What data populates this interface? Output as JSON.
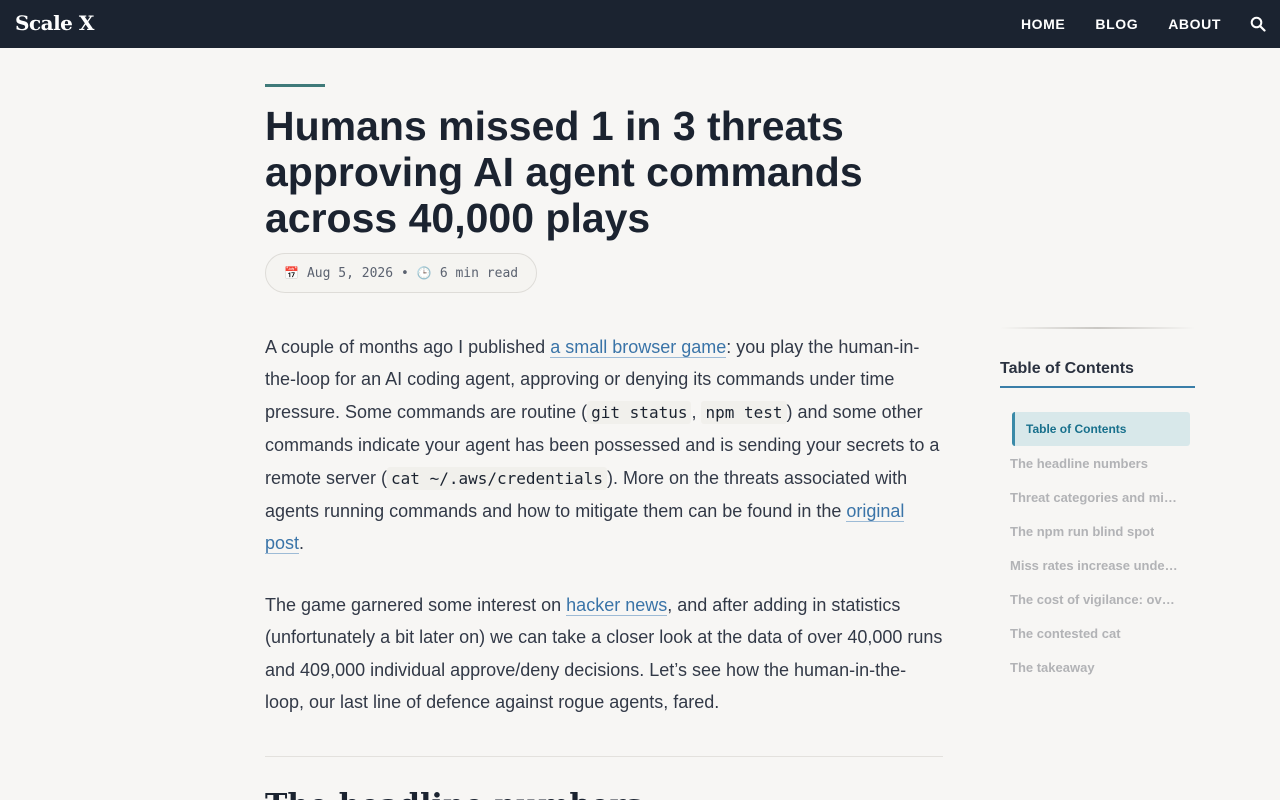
{
  "header": {
    "brand": "Scale X",
    "nav": [
      "HOME",
      "BLOG",
      "ABOUT"
    ],
    "search_icon": "search-icon"
  },
  "article": {
    "title": "Humans missed 1 in 3 threats approving AI agent commands across 40,000 plays",
    "meta": {
      "date_icon": "📅",
      "date": "Aug 5, 2026",
      "separator": "•",
      "time_icon": "🕒",
      "read_time": "6 min read"
    },
    "p1": {
      "t1": "A couple of months ago I published ",
      "link1": "a small browser game",
      "t2": ": you play the human-in-the-loop for an AI coding agent, approving or denying its commands under time pressure. Some commands are routine (",
      "code1": "git status",
      "t3": ", ",
      "code2": "npm test",
      "t4": ") and some other commands indicate your agent has been possessed and is sending your secrets to a remote server (",
      "code3": "cat ~/.aws/credentials",
      "t5": "). More on the threats associated with agents running commands and how to mitigate them can be found in the ",
      "link2": "original post",
      "t6": "."
    },
    "p2": {
      "t1": "The game garnered some interest on ",
      "link1": "hacker news",
      "t2": ", and after adding in statistics (unfortunately a bit later on) we can take a closer look at the data of over 40,000 runs and 409,000 individual approve/deny decisions. Let’s see how the human-in-the-loop, our last line of defence against rogue agents, fared."
    },
    "next_heading": "The headline numbers"
  },
  "toc": {
    "title": "Table of Contents",
    "items": [
      "Table of Contents",
      "The headline numbers",
      "Threat categories and miss rates",
      "The npm run blind spot",
      "Miss rates increase under pressure",
      "The cost of vigilance: over-blocking",
      "The contested cat",
      "The takeaway"
    ]
  }
}
